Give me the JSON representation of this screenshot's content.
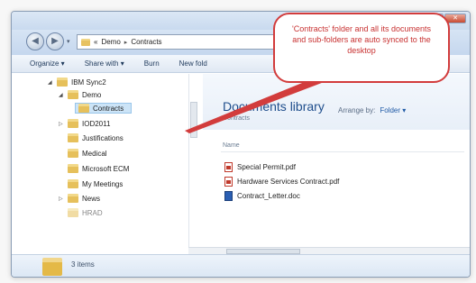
{
  "window": {
    "minimize_glyph": "–",
    "maximize_glyph": "□",
    "close_glyph": "✕"
  },
  "navigation": {
    "back_glyph": "◀",
    "forward_glyph": "▶",
    "dropdown_glyph": "▾",
    "address": {
      "prefix": "«",
      "segments": [
        "Demo",
        "Contracts"
      ],
      "separator": "▸"
    }
  },
  "toolbar": {
    "organize_label": "Organize ▾",
    "share_label": "Share with ▾",
    "burn_label": "Burn",
    "new_folder_label": "New fold"
  },
  "tree": {
    "items": [
      {
        "label": "IBM Sync2",
        "arrow": "◢",
        "icon": "folder-icon"
      },
      {
        "label": "Demo",
        "arrow": "◢",
        "icon": "folder-icon"
      },
      {
        "label": "Contracts",
        "arrow": "",
        "icon": "folder-icon",
        "selected": true
      },
      {
        "label": "IOD2011",
        "arrow": "▷",
        "icon": "folder-icon"
      },
      {
        "label": "Justifications",
        "arrow": "",
        "icon": "folder-icon"
      },
      {
        "label": "Medical",
        "arrow": "",
        "icon": "folder-icon"
      },
      {
        "label": "Microsoft ECM",
        "arrow": "",
        "icon": "folder-icon"
      },
      {
        "label": "My Meetings",
        "arrow": "",
        "icon": "folder-icon"
      },
      {
        "label": "News",
        "arrow": "▷",
        "icon": "folder-icon"
      },
      {
        "label": "HRAD",
        "arrow": "",
        "icon": "folder-icon"
      }
    ]
  },
  "library": {
    "title": "Documents library",
    "subtitle": "Contracts",
    "arrange_label": "Arrange by:",
    "arrange_value": "Folder ▾",
    "column_name": "Name"
  },
  "files": [
    {
      "name": "Special Permit.pdf",
      "icon": "pdf-icon"
    },
    {
      "name": "Hardware Services Contract.pdf",
      "icon": "pdf-icon"
    },
    {
      "name": "Contract_Letter.doc",
      "icon": "word-doc-icon"
    }
  ],
  "details": {
    "item_count": "3 items"
  },
  "callout": {
    "text": "'Contracts' folder and all its documents and sub-folders are auto synced to the desktop",
    "border_color": "#d23c3c",
    "text_color": "#c83232"
  },
  "colors": {
    "folder": "#e6c05b",
    "selection": "#cce4f7",
    "link": "#1f4e8c"
  }
}
